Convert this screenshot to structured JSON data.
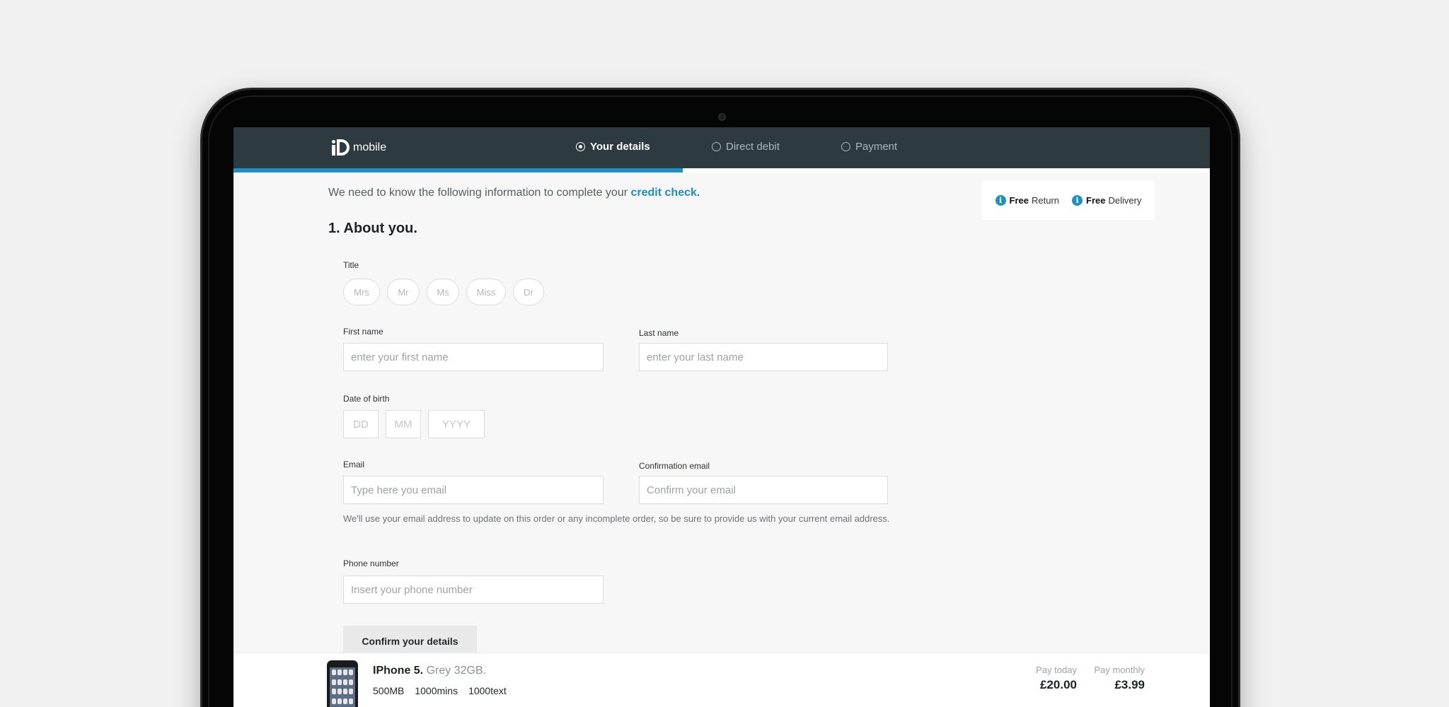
{
  "header": {
    "logo_text": "mobile",
    "steps": [
      {
        "label": "Your details",
        "active": true
      },
      {
        "label": "Direct debit",
        "active": false
      },
      {
        "label": "Payment",
        "active": false
      }
    ],
    "progress": 0.46
  },
  "intro": {
    "text": "We need to know the following information to complete your ",
    "link": "credit check."
  },
  "perks": [
    {
      "bold": "Free",
      "text": "Return"
    },
    {
      "bold": "Free",
      "text": "Delivery"
    }
  ],
  "section": {
    "title": "1. About you."
  },
  "form": {
    "title_label": "Title",
    "title_options": [
      "Mrs",
      "Mr",
      "Ms",
      "Miss",
      "Dr"
    ],
    "first_name": {
      "label": "First name",
      "placeholder": "enter your first name"
    },
    "last_name": {
      "label": "Last name",
      "placeholder": "enter your last name"
    },
    "dob": {
      "label": "Date of birth",
      "dd": "DD",
      "mm": "MM",
      "yyyy": "YYYY"
    },
    "email": {
      "label": "Email",
      "placeholder": "Type here you email"
    },
    "confirm_email": {
      "label": "Confirmation email",
      "placeholder": "Confirm your email"
    },
    "email_help": "We'll use your email address to update on this order or any incomplete order, so be sure to provide us with your current email address.",
    "phone": {
      "label": "Phone number",
      "placeholder": "Insert your phone number"
    },
    "submit": "Confirm your details"
  },
  "basket": {
    "product_name": "IPhone 5.",
    "product_spec": "Grey 32GB.",
    "features": [
      "500MB",
      "1000mins",
      "1000text"
    ],
    "pay_today_label": "Pay today",
    "pay_today": "£20.00",
    "pay_monthly_label": "Pay monthly",
    "pay_monthly": "£3.99"
  },
  "colors": {
    "accent": "#1d8fc0",
    "header_bg": "#2d3b41"
  }
}
